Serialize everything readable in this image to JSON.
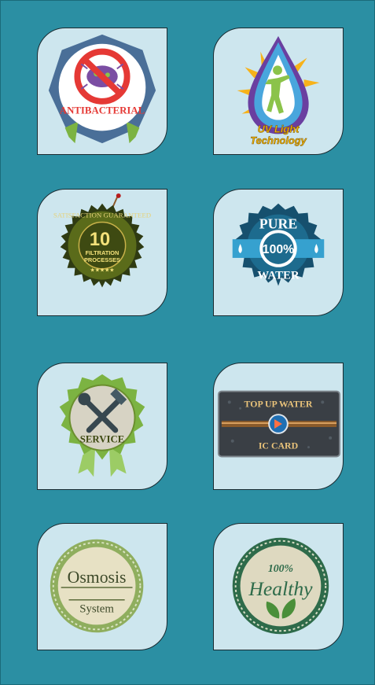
{
  "badges": [
    {
      "label": "ANTIBACTERIAL",
      "icon": "no-bacteria-icon"
    },
    {
      "label_line1": "UV Light",
      "label_line2": "Technology",
      "icon": "water-drop-person-icon"
    },
    {
      "ring_text": "SATISFACTION GUARANTEED",
      "number": "10",
      "line1": "FILTRATION",
      "line2": "PROCESSES",
      "stars": "★★★★★",
      "icon": "seal-icon"
    },
    {
      "top": "PURE",
      "percent": "100%",
      "bottom": "WATER",
      "icon": "gear-badge-icon"
    },
    {
      "label": "SERVICE",
      "icon": "wrench-hammer-icon"
    },
    {
      "top": "TOP UP  WATER",
      "bottom": "IC CARD",
      "icon": "ic-card-icon"
    },
    {
      "line1": "Osmosis",
      "line2": "System",
      "icon": "stamp-icon"
    },
    {
      "line1": "100%",
      "line2": "Healthy",
      "icon": "leaf-icon"
    }
  ],
  "colors": {
    "background": "#2b8fa3",
    "tile": "#cde6ee"
  }
}
